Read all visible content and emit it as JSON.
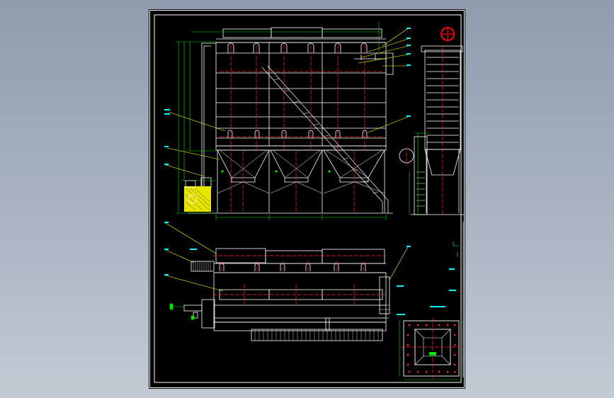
{
  "viewer": {
    "background_top": "#8f9cae",
    "background_bottom": "#c3cad4"
  },
  "drawing": {
    "colors": {
      "paper": "#000000",
      "structure": "#ffffff",
      "centerline": "#ff2a2a",
      "dimension": "#00e000",
      "leader": "#ffff00",
      "text": "#00ffff",
      "highlight": "#ff0000"
    },
    "views": [
      "front-elevation",
      "side-elevation",
      "plan-view",
      "section-detail"
    ],
    "callout_labels": [
      "",
      "",
      "",
      "",
      "",
      "",
      "",
      "",
      "",
      "",
      "",
      "",
      "",
      ""
    ],
    "notes": [
      "",
      ""
    ]
  }
}
